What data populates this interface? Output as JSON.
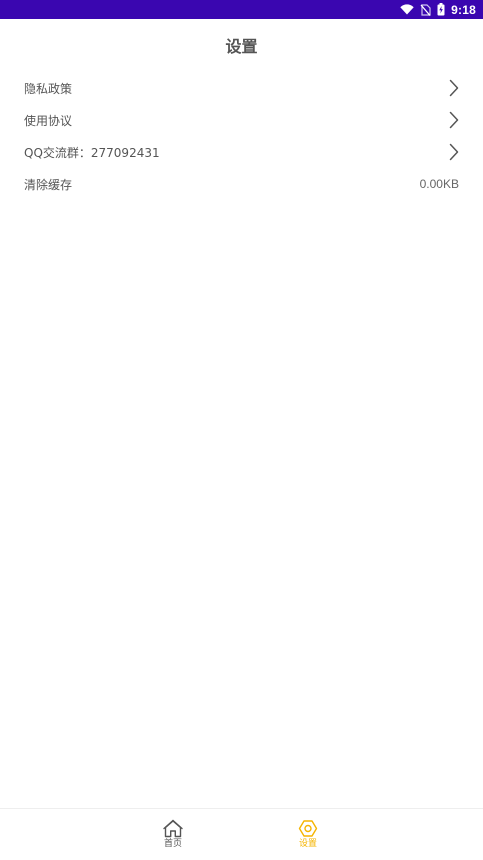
{
  "status_bar": {
    "time": "9:18",
    "icons": [
      "wifi-icon",
      "no-sim-icon",
      "battery-charging-icon"
    ]
  },
  "header": {
    "title": "设置"
  },
  "settings": {
    "items": [
      {
        "label": "隐私政策",
        "icon": "chevron-right-icon"
      },
      {
        "label": "使用协议",
        "icon": "chevron-right-icon"
      },
      {
        "label": "QQ交流群：277092431",
        "icon": "chevron-right-icon"
      },
      {
        "label": "清除缓存",
        "value": "0.00KB"
      }
    ]
  },
  "bottom_nav": {
    "items": [
      {
        "label": "首页",
        "icon": "home-icon",
        "active": false
      },
      {
        "label": "设置",
        "icon": "settings-icon",
        "active": true
      }
    ]
  },
  "colors": {
    "status_bar": "#3a06b0",
    "accent": "#f5b400",
    "text": "#555555"
  }
}
